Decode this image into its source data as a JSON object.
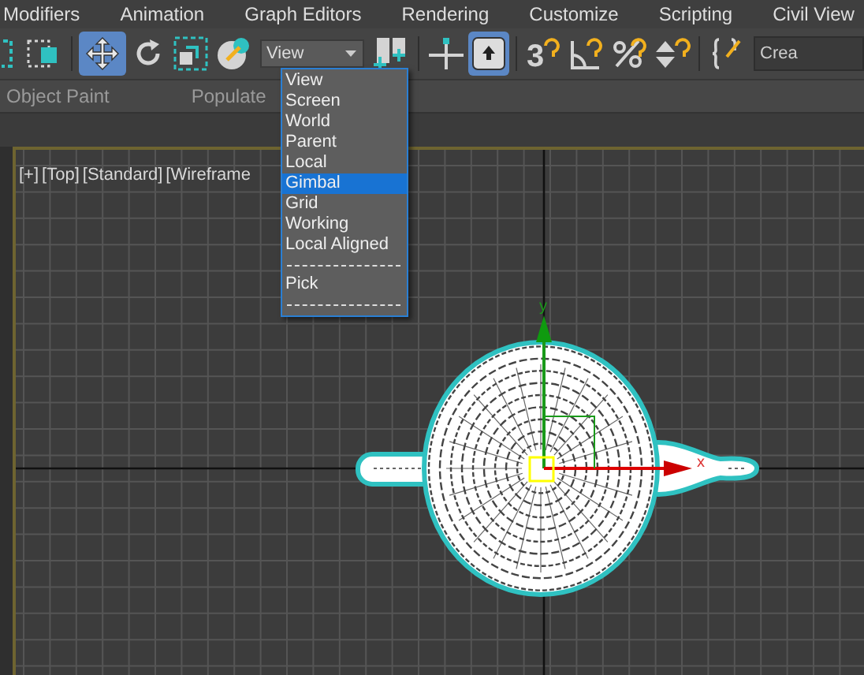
{
  "menu_bar": [
    "Modifiers",
    "Animation",
    "Graph Editors",
    "Rendering",
    "Customize",
    "Scripting",
    "Civil View"
  ],
  "toolbar": {
    "buttons": [
      {
        "kind": "region",
        "selected": false
      },
      {
        "kind": "select-object",
        "selected": false
      },
      {
        "kind": "move",
        "selected": true
      },
      {
        "kind": "rotate",
        "selected": false
      },
      {
        "kind": "scale",
        "selected": false
      },
      {
        "kind": "place",
        "selected": false
      },
      {
        "kind": "combo"
      },
      {
        "kind": "pivot",
        "selected": false
      },
      {
        "kind": "snap-cross",
        "selected": false
      },
      {
        "kind": "select-parent",
        "selected": true
      },
      {
        "kind": "snap-3d",
        "label": "3",
        "selected": false
      },
      {
        "kind": "angle-snap",
        "selected": false
      },
      {
        "kind": "percent-snap",
        "selected": false
      },
      {
        "kind": "spinner-snap",
        "selected": false
      },
      {
        "kind": "script",
        "selected": false
      }
    ],
    "coordinate_system": {
      "value": "View",
      "expanded": true
    },
    "selection_set_field": {
      "value": "Crea"
    }
  },
  "coordinate_menu": [
    {
      "kind": "item",
      "label": "View",
      "selected": false
    },
    {
      "kind": "item",
      "label": "Screen",
      "selected": false
    },
    {
      "kind": "item",
      "label": "World",
      "selected": false
    },
    {
      "kind": "item",
      "label": "Parent",
      "selected": false
    },
    {
      "kind": "item",
      "label": "Local",
      "selected": false
    },
    {
      "kind": "item",
      "label": "Gimbal",
      "selected": true
    },
    {
      "kind": "item",
      "label": "Grid",
      "selected": false
    },
    {
      "kind": "item",
      "label": "Working",
      "selected": false
    },
    {
      "kind": "item",
      "label": "Local Aligned",
      "selected": false
    },
    {
      "kind": "separator"
    },
    {
      "kind": "item",
      "label": "Pick",
      "selected": false
    },
    {
      "kind": "separator"
    }
  ],
  "ribbon_tabs": [
    "Object Paint",
    "Populate"
  ],
  "viewport": {
    "labels": [
      "[+]",
      "[Top]",
      "[Standard]",
      "[Wireframe"
    ],
    "gizmo": {
      "y_label": "y",
      "x_label": "x"
    }
  }
}
